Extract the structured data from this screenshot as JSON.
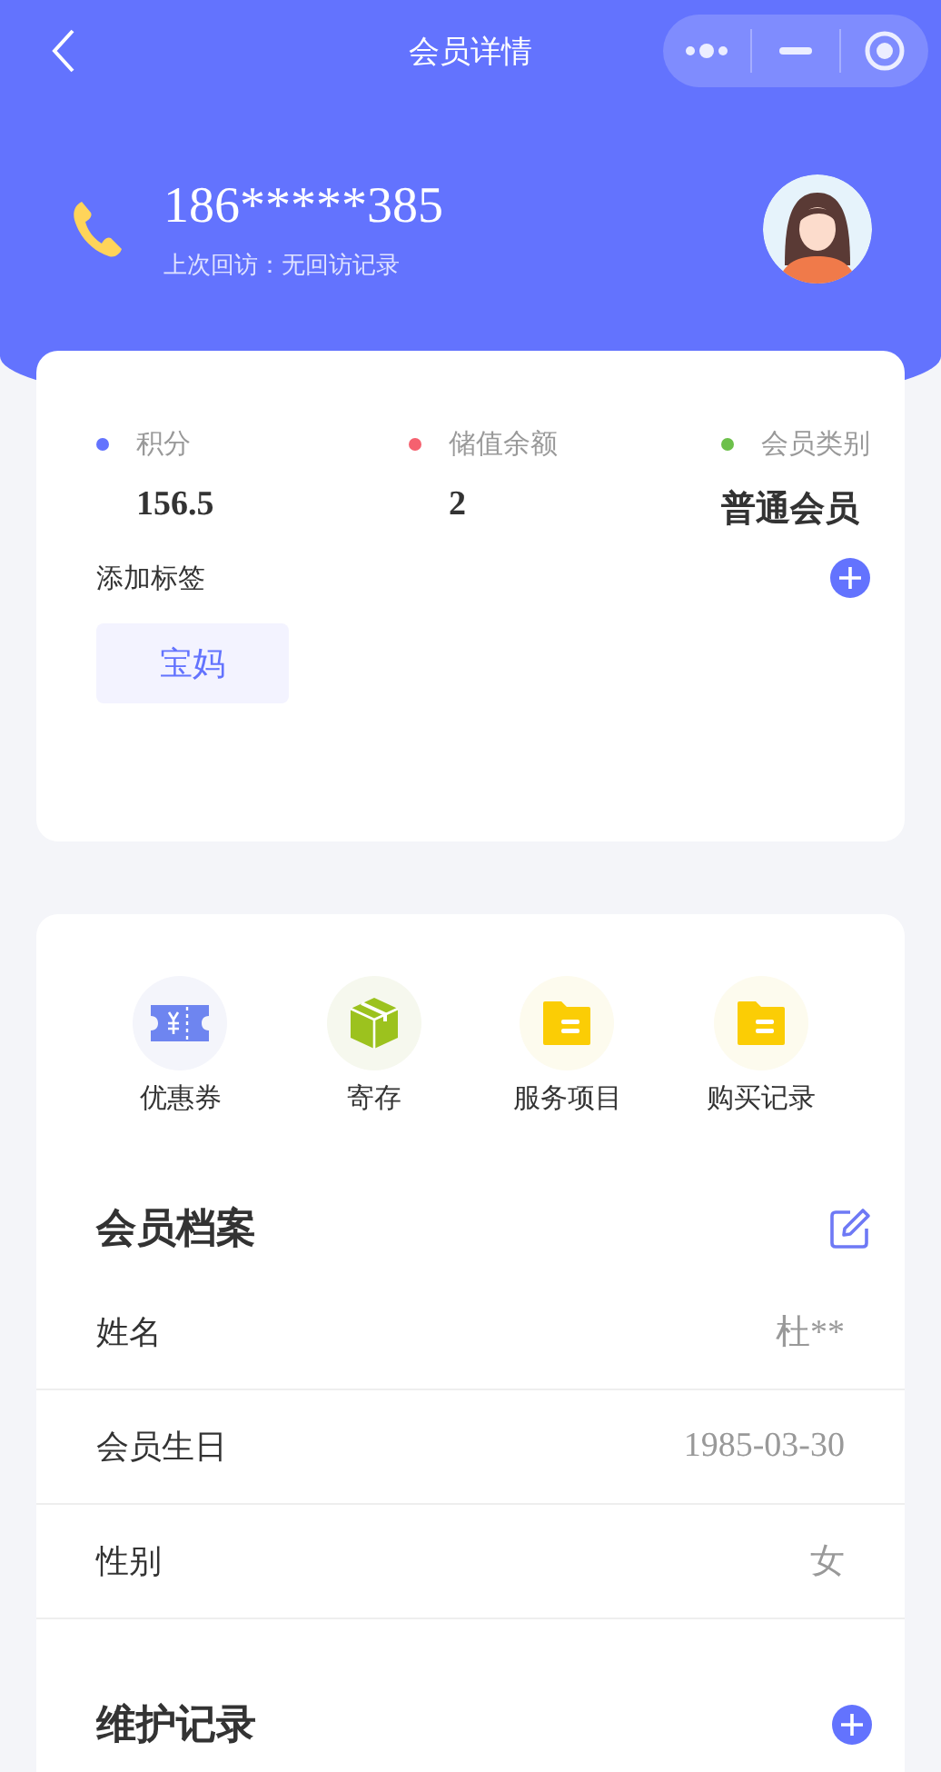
{
  "nav": {
    "title": "会员详情"
  },
  "profile": {
    "phone": "186*****385",
    "last_visit": "上次回访：无回访记录"
  },
  "stats": [
    {
      "label": "积分",
      "value": "156.5",
      "color": "#6373fe",
      "kind": "number"
    },
    {
      "label": "储值余额",
      "value": "2",
      "color": "#f5616f",
      "kind": "number"
    },
    {
      "label": "会员类别",
      "value": "普通会员",
      "color": "#6cc04a",
      "kind": "text"
    }
  ],
  "tags": {
    "title": "添加标签",
    "items": [
      "宝妈"
    ]
  },
  "shortcuts": [
    {
      "label": "优惠券",
      "kind": "coupon"
    },
    {
      "label": "寄存",
      "kind": "box"
    },
    {
      "label": "服务项目",
      "kind": "folder"
    },
    {
      "label": "购买记录",
      "kind": "folder"
    }
  ],
  "archive": {
    "title": "会员档案",
    "fields": [
      {
        "label": "姓名",
        "value": "杜**"
      },
      {
        "label": "会员生日",
        "value": "1985-03-30"
      },
      {
        "label": "性别",
        "value": "女"
      }
    ]
  },
  "maintenance": {
    "title": "维护记录"
  }
}
